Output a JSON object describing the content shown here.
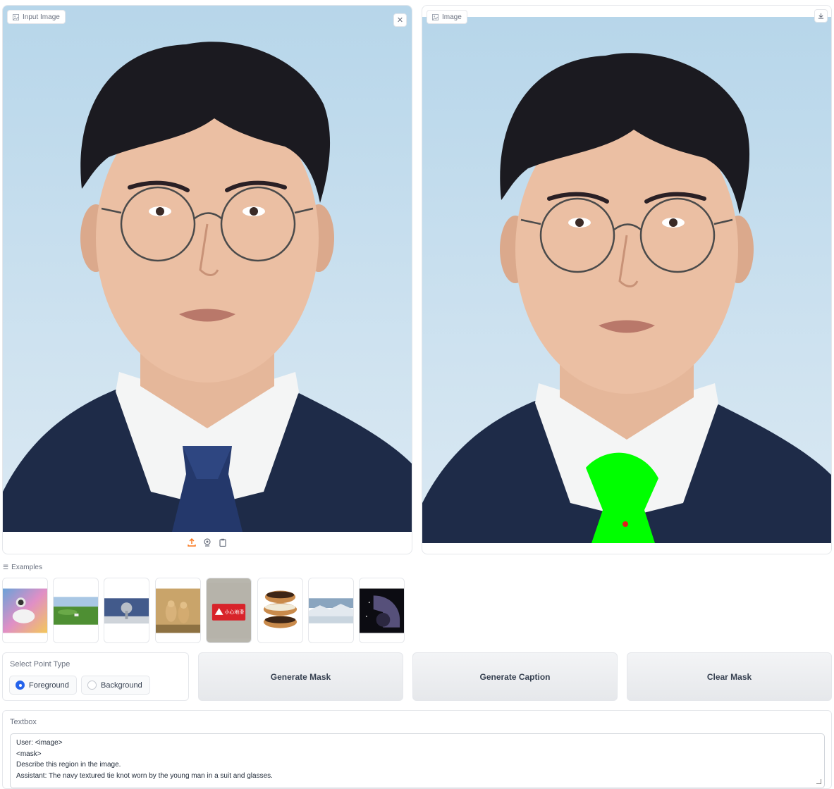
{
  "input_panel": {
    "label": "Input Image",
    "clear_icon": "close-icon",
    "toolbar_icons": [
      "upload-icon",
      "webcam-icon",
      "clipboard-icon"
    ]
  },
  "output_panel": {
    "label": "Image",
    "download_icon": "download-icon"
  },
  "examples": {
    "label": "Examples",
    "items": [
      {
        "name": "example-astronaut-unicorn"
      },
      {
        "name": "example-green-landscape"
      },
      {
        "name": "example-tree-sculpture"
      },
      {
        "name": "example-cheetahs"
      },
      {
        "name": "example-warning-sign",
        "sign_text": "小心地滑"
      },
      {
        "name": "example-donuts"
      },
      {
        "name": "example-snowy-landscape"
      },
      {
        "name": "example-space-diagram"
      }
    ]
  },
  "point_type": {
    "title": "Select Point Type",
    "options": [
      "Foreground",
      "Background"
    ],
    "selected": "Foreground"
  },
  "buttons": {
    "generate_mask": "Generate Mask",
    "generate_caption": "Generate Caption",
    "clear_mask": "Clear Mask"
  },
  "textbox": {
    "label": "Textbox",
    "value": "User: <image>\n<mask>\nDescribe this region in the image.\nAssistant: The navy textured tie knot worn by the young man in a suit and glasses."
  },
  "colors": {
    "mask": "#00ff00",
    "point": "#e11d1d",
    "accent": "#2563eb",
    "upload_accent": "#f97316"
  }
}
